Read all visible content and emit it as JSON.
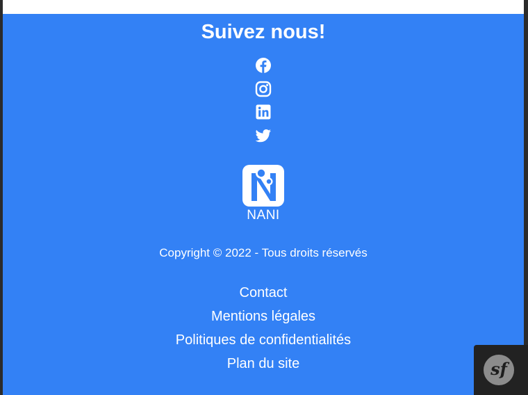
{
  "footer": {
    "follow_title": "Suivez nous!",
    "socials": [
      {
        "icon": "facebook-icon"
      },
      {
        "icon": "instagram-icon"
      },
      {
        "icon": "linkedin-icon"
      },
      {
        "icon": "twitter-icon"
      }
    ],
    "brand_name": "NANI",
    "copyright": "Copyright © 2022 - Tous droits réservés",
    "links": [
      "Contact",
      "Mentions légales",
      "Politiques de confidentialités",
      "Plan du site"
    ]
  },
  "debug_toolbar": {
    "logo_text": "sf"
  },
  "colors": {
    "footer_background": "#3381f5",
    "text": "#ffffff",
    "toolbar_background": "#222222"
  }
}
